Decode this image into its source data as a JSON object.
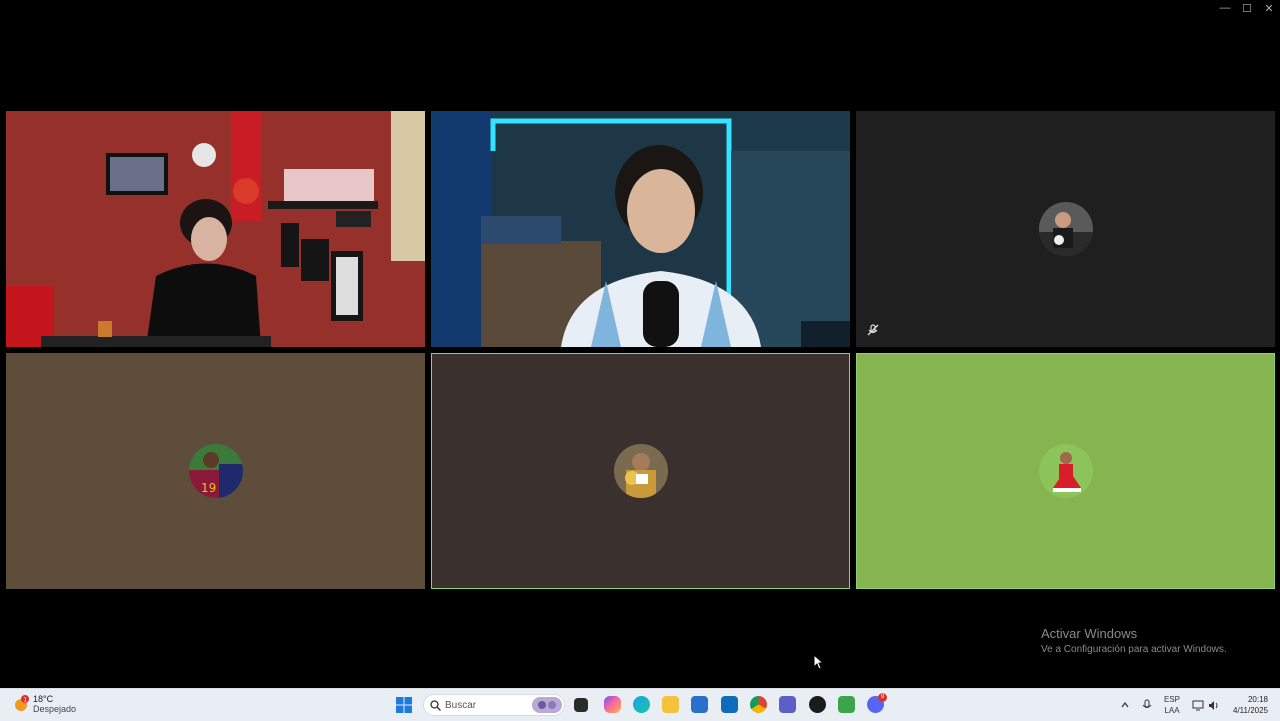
{
  "window": {
    "controls": [
      "—",
      "☐",
      "✕"
    ]
  },
  "tiles": [
    {
      "id": "p1",
      "kind": "video",
      "description_icon": "camera-feed"
    },
    {
      "id": "p2",
      "kind": "video",
      "description_icon": "camera-feed"
    },
    {
      "id": "p3",
      "kind": "avatar",
      "bg": "#1f1f1f",
      "muted": true
    },
    {
      "id": "p4",
      "kind": "avatar",
      "bg": "#5f4d3c",
      "muted": false,
      "avatar_text": "19"
    },
    {
      "id": "p5",
      "kind": "avatar",
      "bg": "#3a302e",
      "muted": false,
      "speaking": true
    },
    {
      "id": "p6",
      "kind": "avatar",
      "bg": "#85b450",
      "muted": false,
      "speaking": true
    }
  ],
  "watermark": {
    "title": "Activar Windows",
    "subtitle": "Ve a Configuración para activar Windows."
  },
  "taskbar": {
    "weather": {
      "temp": "18°C",
      "desc": "Despejado",
      "badge": "1"
    },
    "search_placeholder": "Buscar",
    "language": {
      "lang": "ESP",
      "layout": "LAA"
    },
    "clock": {
      "time": "20:18",
      "date": "4/11/2025"
    },
    "discord_badge": "9"
  }
}
